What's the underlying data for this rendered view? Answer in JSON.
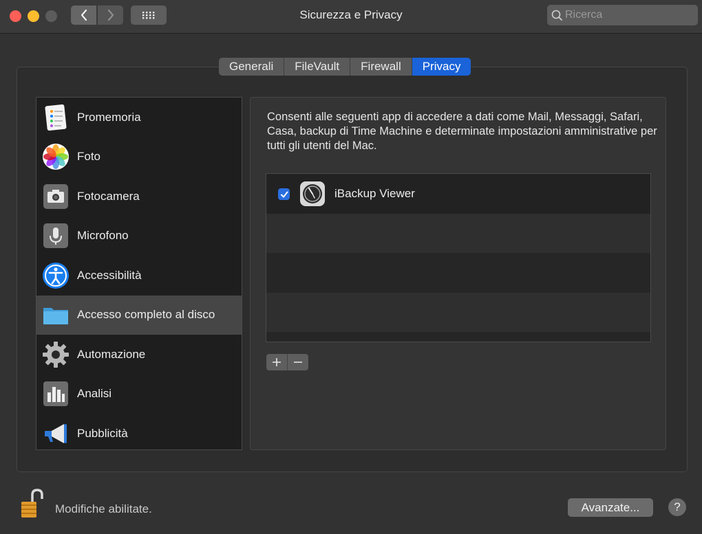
{
  "window": {
    "title": "Sicurezza e Privacy"
  },
  "search": {
    "placeholder": "Ricerca"
  },
  "tabs": [
    {
      "label": "Generali",
      "active": false
    },
    {
      "label": "FileVault",
      "active": false
    },
    {
      "label": "Firewall",
      "active": false
    },
    {
      "label": "Privacy",
      "active": true
    }
  ],
  "sidebar": {
    "items": [
      {
        "label": "Promemoria",
        "icon": "reminders-icon"
      },
      {
        "label": "Foto",
        "icon": "photos-icon"
      },
      {
        "label": "Fotocamera",
        "icon": "camera-icon"
      },
      {
        "label": "Microfono",
        "icon": "microphone-icon"
      },
      {
        "label": "Accessibilità",
        "icon": "accessibility-icon"
      },
      {
        "label": "Accesso completo al disco",
        "icon": "folder-icon",
        "selected": true
      },
      {
        "label": "Automazione",
        "icon": "gear-icon"
      },
      {
        "label": "Analisi",
        "icon": "analytics-icon"
      },
      {
        "label": "Pubblicità",
        "icon": "megaphone-icon"
      }
    ]
  },
  "panel": {
    "description": "Consenti alle seguenti app di accedere a dati come Mail, Messaggi, Safari, Casa, backup di Time Machine e determinate impostazioni amministrative per tutti gli utenti del Mac.",
    "apps": [
      {
        "name": "iBackup Viewer",
        "checked": true,
        "icon": "ibackup-viewer-icon"
      }
    ],
    "add_label": "+",
    "remove_label": "−"
  },
  "footer": {
    "status": "Modifiche abilitate.",
    "advanced_label": "Avanzate...",
    "help_label": "?"
  },
  "colors": {
    "accent": "#1a63d8",
    "checkbox": "#2a6fe0",
    "background": "#323232"
  }
}
